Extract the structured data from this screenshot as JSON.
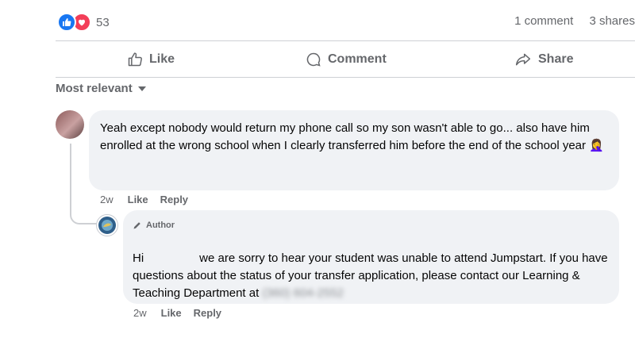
{
  "reactions": {
    "count": "53",
    "icons": [
      "like-icon",
      "love-icon"
    ],
    "like_color": "#1877f2",
    "love_color": "#f33e58"
  },
  "counts": {
    "comments": "1 comment",
    "shares": "3 shares"
  },
  "actions": {
    "like": "Like",
    "comment": "Comment",
    "share": "Share"
  },
  "sort": {
    "label": "Most relevant"
  },
  "comment": {
    "text": "Yeah except nobody would return my phone call so my son wasn't able to go... also have him enrolled at the wrong school when I clearly transferred him before the end of the school year",
    "emoji": "🤦‍♀️",
    "time": "2w",
    "like": "Like",
    "reply": "Reply"
  },
  "reply": {
    "badge": "Author",
    "greeting": "Hi",
    "text": "we are sorry to hear your student was unable to attend Jumpstart. If you have questions about the status of your transfer application, please contact our Learning & Teaching Department at",
    "phone": "(360) 604-2552",
    "time": "2w",
    "like": "Like",
    "reply": "Reply"
  },
  "colors": {
    "bubble": "#f0f2f5",
    "muted": "#65676b",
    "divider": "#ced0d4"
  }
}
